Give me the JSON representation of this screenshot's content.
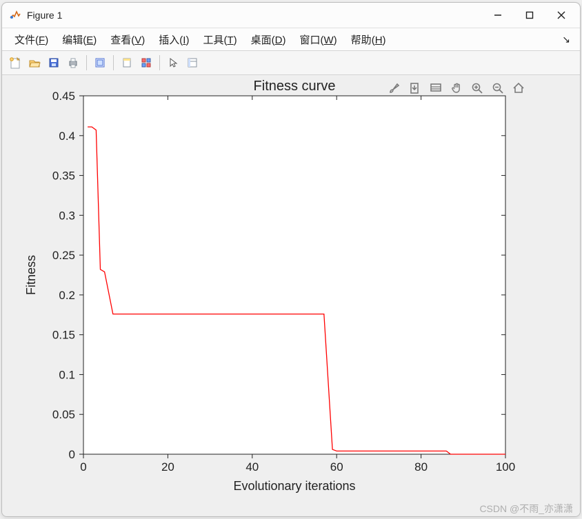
{
  "window": {
    "title": "Figure 1"
  },
  "menubar": {
    "file": {
      "label": "文件",
      "mn": "F"
    },
    "edit": {
      "label": "编辑",
      "mn": "E"
    },
    "view": {
      "label": "查看",
      "mn": "V"
    },
    "insert": {
      "label": "插入",
      "mn": "I"
    },
    "tools": {
      "label": "工具",
      "mn": "T"
    },
    "desktop": {
      "label": "桌面",
      "mn": "D"
    },
    "window": {
      "label": "窗口",
      "mn": "W"
    },
    "help": {
      "label": "帮助",
      "mn": "H"
    }
  },
  "toolbar": {
    "icons": [
      "new-figure",
      "open",
      "save",
      "print",
      "sep",
      "print-preview",
      "sep",
      "dock",
      "tile",
      "sep",
      "pointer",
      "inspect"
    ]
  },
  "axes_toolbar": {
    "icons": [
      "brush",
      "save-axes",
      "datatip",
      "pan",
      "zoom-in",
      "zoom-out",
      "home"
    ]
  },
  "chart_data": {
    "type": "line",
    "title": "Fitness curve",
    "xlabel": "Evolutionary iterations",
    "ylabel": "Fitness",
    "xlim": [
      0,
      100
    ],
    "ylim": [
      0,
      0.45
    ],
    "xticks": [
      0,
      20,
      40,
      60,
      80,
      100
    ],
    "yticks": [
      0,
      0.05,
      0.1,
      0.15,
      0.2,
      0.25,
      0.3,
      0.35,
      0.4,
      0.45
    ],
    "series": [
      {
        "name": "fitness",
        "color": "#ff0000",
        "x": [
          1,
          2,
          3,
          4,
          5,
          7,
          57,
          59,
          60,
          86,
          87,
          100
        ],
        "y": [
          0.411,
          0.411,
          0.407,
          0.232,
          0.229,
          0.176,
          0.176,
          0.006,
          0.004,
          0.004,
          0.0,
          0.0
        ]
      }
    ]
  },
  "watermark": "CSDN @不雨_亦潇潇"
}
